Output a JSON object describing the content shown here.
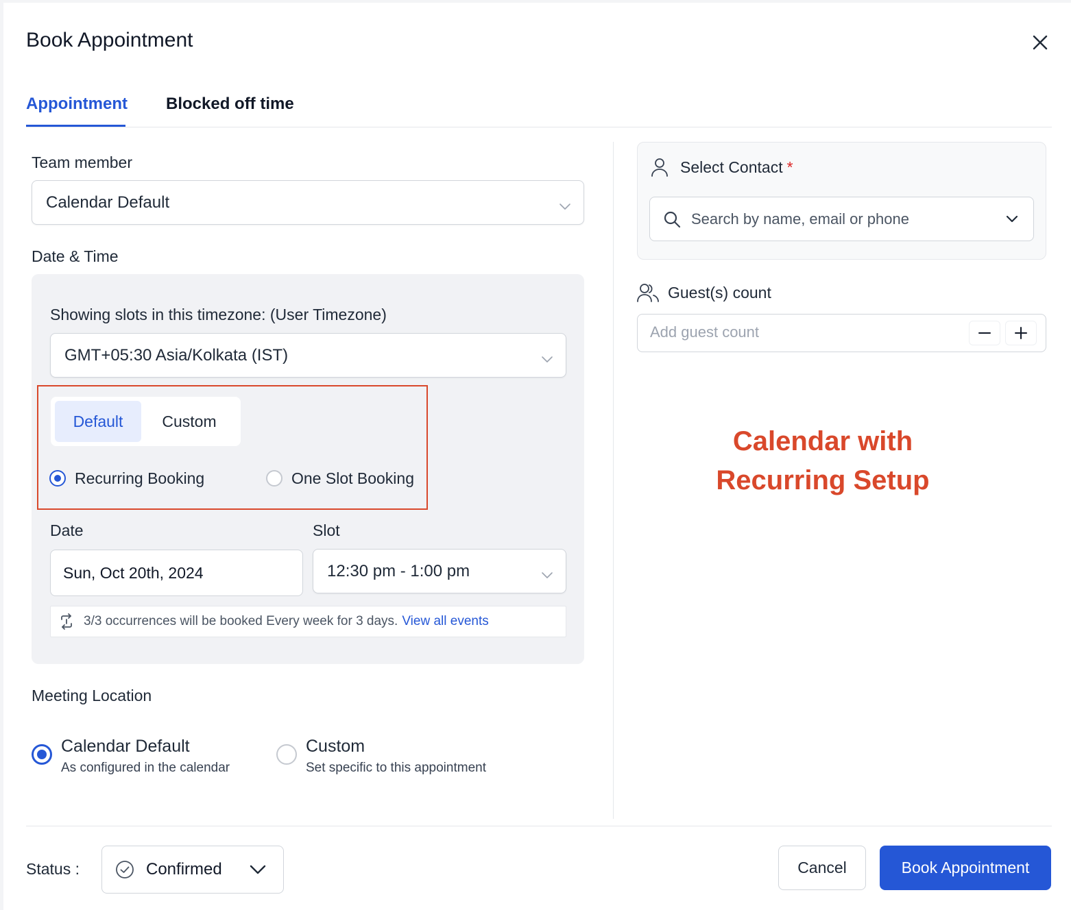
{
  "header": {
    "title": "Book Appointment"
  },
  "tabs": [
    {
      "label": "Appointment",
      "active": true
    },
    {
      "label": "Blocked off time",
      "active": false
    }
  ],
  "team_member": {
    "label": "Team member",
    "value": "Calendar Default"
  },
  "date_time": {
    "label": "Date & Time",
    "timezone_label": "Showing slots in this timezone: (User Timezone)",
    "timezone_value": "GMT+05:30 Asia/Kolkata (IST)",
    "mode_options": [
      {
        "label": "Default",
        "selected": true
      },
      {
        "label": "Custom",
        "selected": false
      }
    ],
    "booking_types": [
      {
        "label": "Recurring Booking",
        "selected": true
      },
      {
        "label": "One Slot Booking",
        "selected": false
      }
    ],
    "date_label": "Date",
    "date_value": "Sun, Oct 20th, 2024",
    "slot_label": "Slot",
    "slot_value": "12:30 pm - 1:00 pm",
    "occurrence_text": "3/3 occurrences will be booked Every week for 3 days.",
    "occurrence_link": "View all events"
  },
  "meeting_location": {
    "label": "Meeting Location",
    "options": [
      {
        "title": "Calendar Default",
        "subtitle": "As configured in the calendar",
        "selected": true
      },
      {
        "title": "Custom",
        "subtitle": "Set specific to this appointment",
        "selected": false
      }
    ]
  },
  "contact": {
    "label": "Select Contact",
    "required_mark": "*",
    "search_placeholder": "Search by name, email or phone"
  },
  "guests": {
    "label": "Guest(s) count",
    "placeholder": "Add guest count"
  },
  "annotation": {
    "line1": "Calendar with",
    "line2": "Recurring Setup"
  },
  "footer": {
    "status_label": "Status :",
    "status_value": "Confirmed",
    "cancel_label": "Cancel",
    "book_label": "Book Appointment"
  },
  "colors": {
    "accent": "#2557d6",
    "annotation": "#d9482b",
    "required": "#dc2626"
  }
}
